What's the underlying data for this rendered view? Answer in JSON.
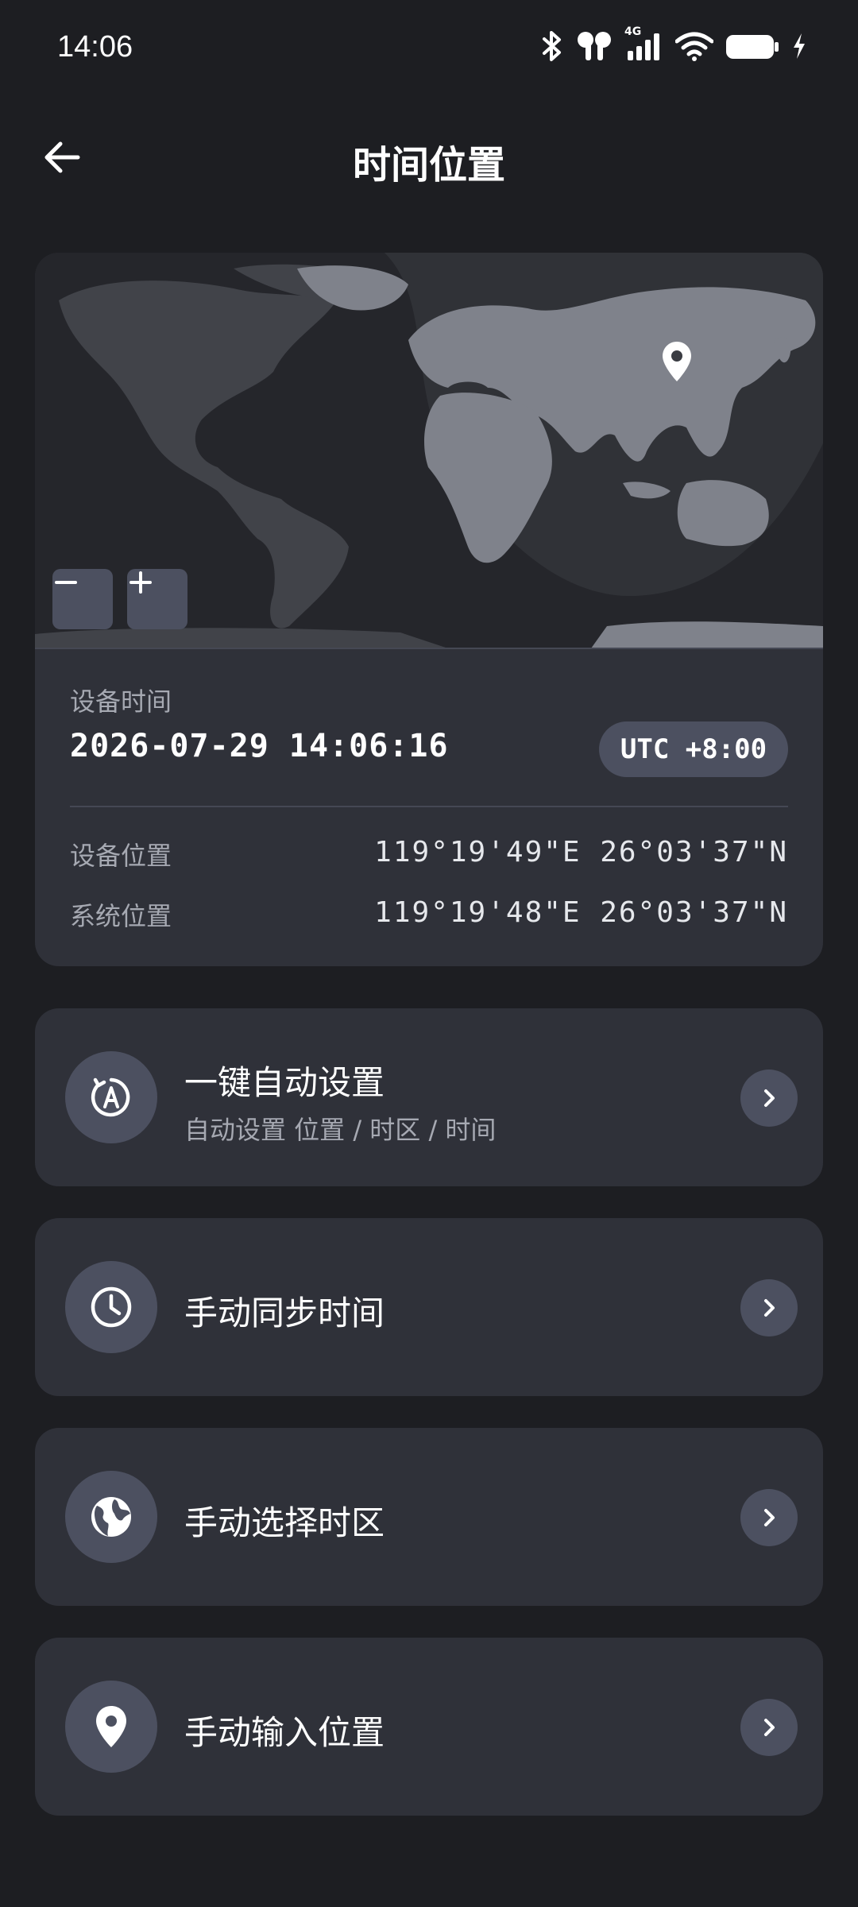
{
  "status_bar": {
    "time": "14:06",
    "network": "4G",
    "icons": [
      "bluetooth-icon",
      "earbuds-icon",
      "signal-icon",
      "wifi-icon",
      "battery-icon",
      "charging-icon"
    ]
  },
  "header": {
    "title": "时间位置",
    "back_icon": "arrow-left-icon"
  },
  "map": {
    "marker_icon": "location-pin-icon",
    "zoom_out_icon": "minus-icon",
    "zoom_in_icon": "plus-icon"
  },
  "device_time": {
    "label": "设备时间",
    "value": "2026-07-29 14:06:16",
    "timezone": "UTC +8:00"
  },
  "locations": [
    {
      "label": "设备位置",
      "value": "119°19'49\"E 26°03'37\"N"
    },
    {
      "label": "系统位置",
      "value": "119°19'48\"E 26°03'37\"N"
    }
  ],
  "actions": [
    {
      "title": "一键自动设置",
      "subtitle": "自动设置 位置 / 时区 / 时间",
      "icon": "auto-rotate-icon"
    },
    {
      "title": "手动同步时间",
      "icon": "clock-icon"
    },
    {
      "title": "手动选择时区",
      "icon": "globe-icon"
    },
    {
      "title": "手动输入位置",
      "icon": "location-pin-icon"
    }
  ],
  "colors": {
    "background": "#1d1e22",
    "card": "#2f3139",
    "button": "#4c5060",
    "land": "#7f828b",
    "night": "#25262b"
  }
}
